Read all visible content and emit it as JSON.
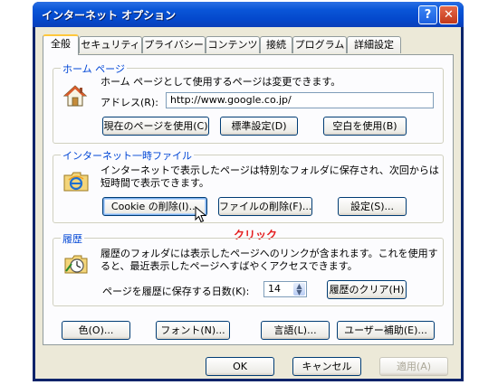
{
  "window": {
    "title": "インターネット オプション",
    "help_glyph": "?",
    "close_glyph": "✕"
  },
  "tabs": [
    "全般",
    "セキュリティ",
    "プライバシー",
    "コンテンツ",
    "接続",
    "プログラム",
    "詳細設定"
  ],
  "home_page": {
    "group_label": "ホーム ページ",
    "description": "ホーム ページとして使用するページは変更できます。",
    "address_label": "アドレス(R):",
    "address_value": "http://www.google.co.jp/",
    "use_current": "現在のページを使用(C)",
    "use_default": "標準設定(D)",
    "use_blank": "空白を使用(B)"
  },
  "temp_files": {
    "group_label": "インターネット一時ファイル",
    "description_line1": "インターネットで表示したページは特別なフォルダに保存され、次回からは",
    "description_line2": "短時間で表示できます。",
    "delete_cookies": "Cookie の削除(I)...",
    "delete_files": "ファイルの削除(F)...",
    "settings": "設定(S)..."
  },
  "annotation": {
    "click_text": "クリック"
  },
  "history": {
    "group_label": "履歴",
    "description_line1": "履歴のフォルダには表示したページへのリンクが含まれます。これを使用す",
    "description_line2": "ると、最近表示したページへすばやくアクセスできます。",
    "days_label": "ページを履歴に保存する日数(K):",
    "days_value": "14",
    "clear_history": "履歴のクリア(H)"
  },
  "bottom_buttons": {
    "colors": "色(O)...",
    "fonts": "フォント(N)...",
    "languages": "言語(L)...",
    "accessibility": "ユーザー補助(E)..."
  },
  "dialog_buttons": {
    "ok": "OK",
    "cancel": "キャンセル",
    "apply": "適用(A)"
  }
}
